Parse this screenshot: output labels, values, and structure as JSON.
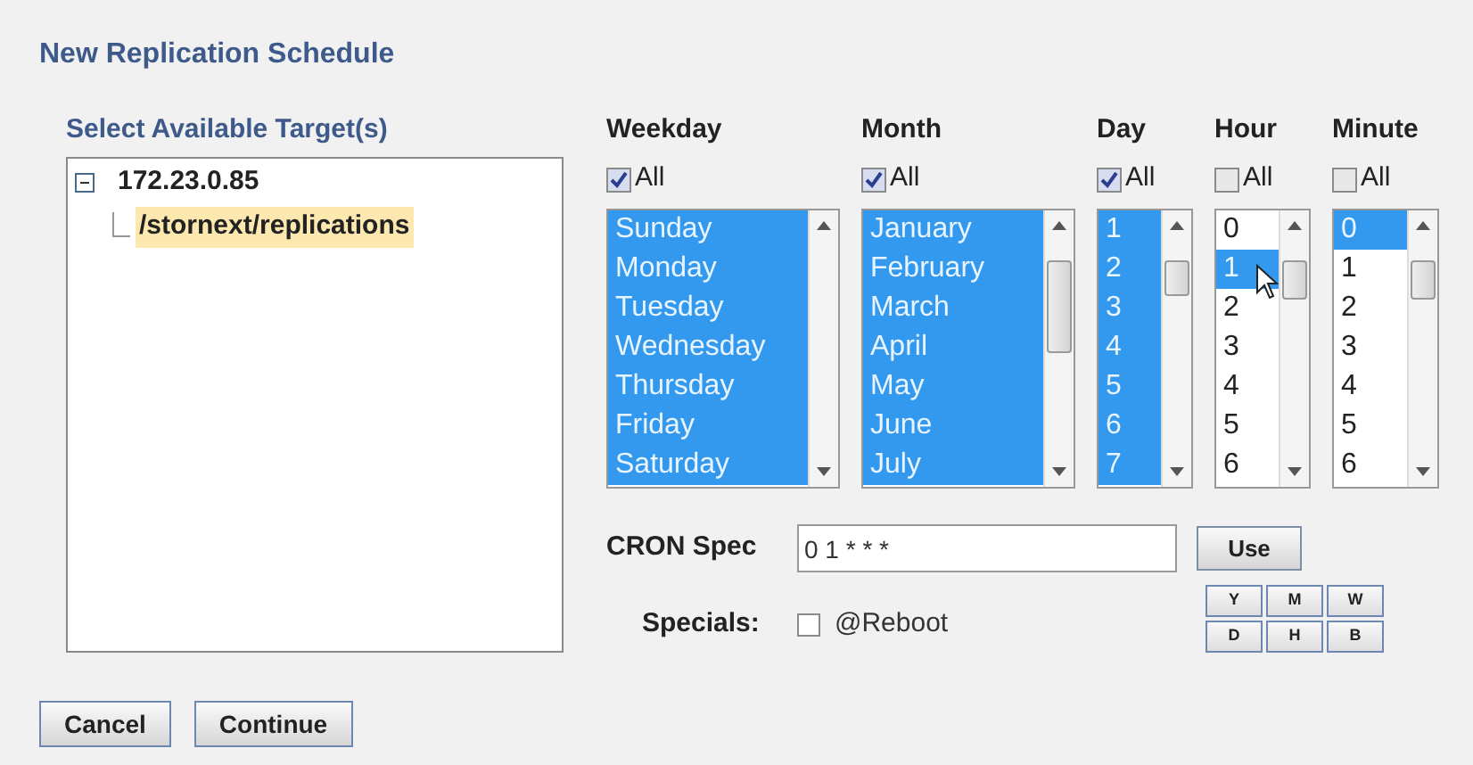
{
  "title": "New Replication Schedule",
  "targets": {
    "label": "Select Available Target(s)",
    "tree": [
      {
        "label": "172.23.0.85",
        "expanded": true,
        "selected": false,
        "children": [
          {
            "label": "/stornext/replications",
            "selected": true
          }
        ]
      }
    ]
  },
  "columns": [
    {
      "label": "Weekday",
      "all_label": "All",
      "all_checked": true,
      "items": [
        {
          "label": "Sunday",
          "selected": true
        },
        {
          "label": "Monday",
          "selected": true
        },
        {
          "label": "Tuesday",
          "selected": true
        },
        {
          "label": "Wednesday",
          "selected": true
        },
        {
          "label": "Thursday",
          "selected": true
        },
        {
          "label": "Friday",
          "selected": true
        },
        {
          "label": "Saturday",
          "selected": true
        }
      ]
    },
    {
      "label": "Month",
      "all_label": "All",
      "all_checked": true,
      "items": [
        {
          "label": "January",
          "selected": true
        },
        {
          "label": "February",
          "selected": true
        },
        {
          "label": "March",
          "selected": true
        },
        {
          "label": "April",
          "selected": true
        },
        {
          "label": "May",
          "selected": true
        },
        {
          "label": "June",
          "selected": true
        },
        {
          "label": "July",
          "selected": true
        }
      ]
    },
    {
      "label": "Day",
      "all_label": "All",
      "all_checked": true,
      "items": [
        {
          "label": "1",
          "selected": true
        },
        {
          "label": "2",
          "selected": true
        },
        {
          "label": "3",
          "selected": true
        },
        {
          "label": "4",
          "selected": true
        },
        {
          "label": "5",
          "selected": true
        },
        {
          "label": "6",
          "selected": true
        },
        {
          "label": "7",
          "selected": true
        }
      ]
    },
    {
      "label": "Hour",
      "all_label": "All",
      "all_checked": false,
      "items": [
        {
          "label": "0",
          "selected": false
        },
        {
          "label": "1",
          "selected": true
        },
        {
          "label": "2",
          "selected": false
        },
        {
          "label": "3",
          "selected": false
        },
        {
          "label": "4",
          "selected": false
        },
        {
          "label": "5",
          "selected": false
        },
        {
          "label": "6",
          "selected": false
        }
      ]
    },
    {
      "label": "Minute",
      "all_label": "All",
      "all_checked": false,
      "items": [
        {
          "label": "0",
          "selected": true
        },
        {
          "label": "1",
          "selected": false
        },
        {
          "label": "2",
          "selected": false
        },
        {
          "label": "3",
          "selected": false
        },
        {
          "label": "4",
          "selected": false
        },
        {
          "label": "5",
          "selected": false
        },
        {
          "label": "6",
          "selected": false
        }
      ]
    }
  ],
  "cron": {
    "label": "CRON Spec",
    "value": "0 1 * * *",
    "button": "Use"
  },
  "specials": {
    "label": "Specials:",
    "option": "@Reboot",
    "checked": false
  },
  "presets": [
    "Y",
    "M",
    "W",
    "D",
    "H",
    "B"
  ],
  "buttons": [
    "Cancel",
    "Continue"
  ]
}
